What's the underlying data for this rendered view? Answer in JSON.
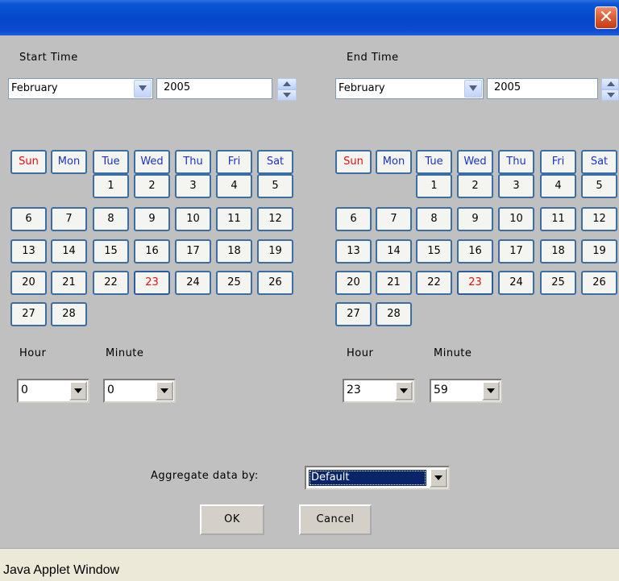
{
  "window": {
    "close_icon": "close-icon",
    "status_text": "Java Applet Window"
  },
  "start": {
    "label": "Start Time",
    "month": "February",
    "year": "2005",
    "hour_label": "Hour",
    "minute_label": "Minute",
    "hour": "0",
    "minute": "0"
  },
  "end": {
    "label": "End Time",
    "month": "February",
    "year": "2005",
    "hour_label": "Hour",
    "minute_label": "Minute",
    "hour": "23",
    "minute": "59"
  },
  "calendar": {
    "weekdays": [
      "Sun",
      "Mon",
      "Tue",
      "Wed",
      "Thu",
      "Fri",
      "Sat"
    ],
    "first_weekday_index": 2,
    "days_in_month": 28,
    "highlighted_day": 23
  },
  "aggregate": {
    "label": "Aggregate data by:",
    "value": "Default"
  },
  "buttons": {
    "ok": "OK",
    "cancel": "Cancel"
  },
  "colors": {
    "title_bar": "#0447c8",
    "weekday_text": "#1a34c8",
    "sunday_text": "#e01010",
    "today_text": "#e01010",
    "selection_bg": "#0a246a"
  }
}
